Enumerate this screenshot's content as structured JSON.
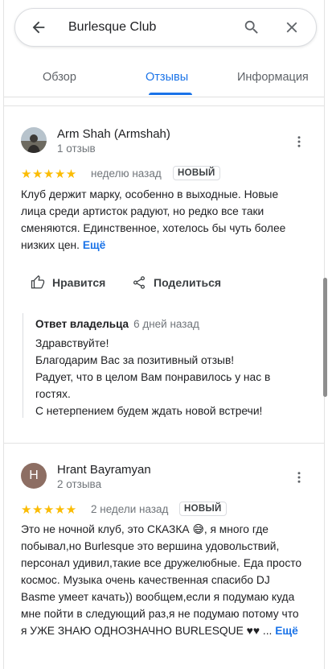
{
  "search": {
    "value": "Burlesque Club"
  },
  "tabs": [
    {
      "label": "Обзор"
    },
    {
      "label": "Отзывы"
    },
    {
      "label": "Информация"
    }
  ],
  "reviews": [
    {
      "author": "Arm Shah (Armshah)",
      "count": "1 отзыв",
      "stars": "★★★★★",
      "rating": 5,
      "date": "неделю назад",
      "badge": "НОВЫЙ",
      "text": "Клуб держит марку, особенно в выходные. Новые лица среди артисток радуют, но редко все таки сменяются. Единственное, хотелось бы чуть более низких цен.",
      "more": "Ещё",
      "like_label": "Нравится",
      "share_label": "Поделиться",
      "owner_reply": {
        "label": "Ответ владельца",
        "date": "6 дней назад",
        "text": "Здравствуйте!\nБлагодарим Вас за позитивный отзыв!\nРадует, что в целом Вам понравилось у нас в гостях.\nС нетерпением будем ждать новой встречи!"
      }
    },
    {
      "author": "Hrant Bayramyan",
      "avatar_letter": "H",
      "count": "2 отзыва",
      "stars": "★★★★★",
      "rating": 5,
      "date": "2 недели назад",
      "badge": "НОВЫЙ",
      "text": "Это не ночной клуб, это СКАЗКА 😅, я много где побывал,но Burlesque  это вершина удовольствий, персонал удивил,такие все дружелюбные. Еда просто космос. Музыка очень качественная спасибо DJ Basme умеет качать)) вообщем,если я подумаю куда мне пойти в следующий раз,я не подумаю потому что я УЖЕ ЗНАЮ ОДНОЗНАЧНО BURLESQUE ♥♥ ...",
      "more": "Ещё"
    }
  ],
  "colors": {
    "accent": "#1a73e8",
    "star": "#fbbc04",
    "avatar_h": "#8d6e63"
  }
}
